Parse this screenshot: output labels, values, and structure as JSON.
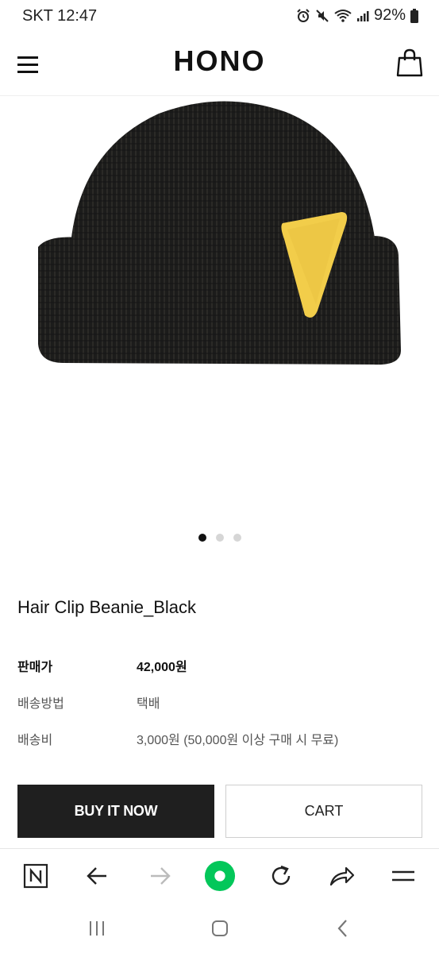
{
  "status_bar": {
    "carrier_time": "SKT 12:47",
    "battery_text": "92%"
  },
  "header": {
    "logo": "HONO"
  },
  "product": {
    "image_icon": "beanie-photo",
    "accent_color": "#f2cd4a",
    "carousel_slide_count": 3,
    "carousel_active_index": 0,
    "title": "Hair Clip Beanie_Black",
    "info": [
      {
        "label": "판매가",
        "value": "42,000원"
      },
      {
        "label": "배송방법",
        "value": "택배"
      },
      {
        "label": "배송비",
        "value": "3,000원 (50,000원 이상 구매 시 무료)"
      }
    ]
  },
  "actions": {
    "buy_now_label": "BUY IT NOW",
    "cart_label": "CART"
  },
  "browser_toolbar": {
    "icons": [
      "naver-home-icon",
      "back-arrow-icon",
      "forward-arrow-icon",
      "green-dot-icon",
      "refresh-icon",
      "share-icon",
      "menu-lines-icon"
    ],
    "brand_color": "#03c75a"
  },
  "system_nav": {
    "icons": [
      "recent-apps-icon",
      "home-icon",
      "back-icon"
    ]
  }
}
